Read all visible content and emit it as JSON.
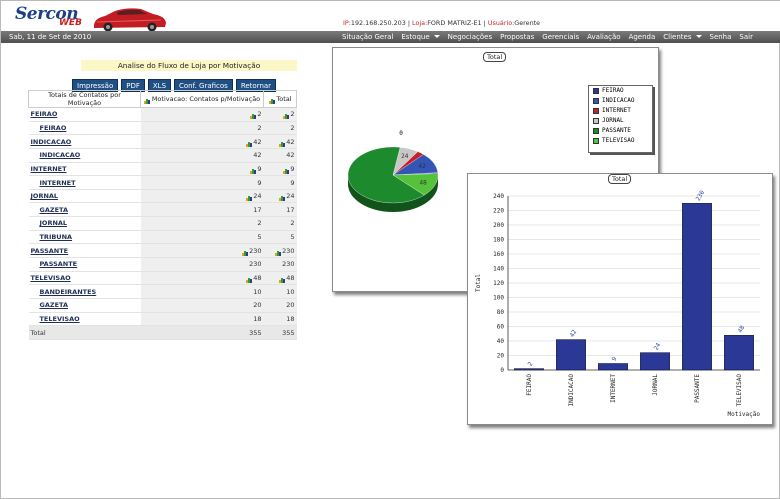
{
  "header": {
    "logo_main": "Sercon",
    "logo_sub": "WEB",
    "ip_label": "IP:",
    "ip_value": "192.168.250.203",
    "sep1": " | ",
    "loja_label": "Loja:",
    "loja_value": "FORD MATRIZ-E1",
    "sep2": " | ",
    "user_label": "Usuário:",
    "user_value": "Gerente"
  },
  "nav": {
    "date": "Sab, 11 de Set de 2010",
    "menu": [
      "Situação Geral",
      "Estoque",
      "Negociações",
      "Propostas",
      "Gerenciais",
      "Avaliação",
      "Agenda",
      "Clientes",
      "Senha",
      "Sair"
    ]
  },
  "report": {
    "title": "Analise do Fluxo de Loja por Motivação",
    "buttons": [
      "Impressão",
      "PDF",
      "XLS",
      "Conf. Graficos",
      "Retornar"
    ],
    "headers": [
      "Totais de Contatos por Motivação",
      "Motivacao: Contatos p/Motivação",
      "Total"
    ],
    "rows": [
      {
        "label": "FEIRAO",
        "v1": "2",
        "v2": "2",
        "type": "group"
      },
      {
        "label": "FEIRAO",
        "v1": "2",
        "v2": "2",
        "type": "sub"
      },
      {
        "label": "INDICACAO",
        "v1": "42",
        "v2": "42",
        "type": "group"
      },
      {
        "label": "INDICACAO",
        "v1": "42",
        "v2": "42",
        "type": "sub"
      },
      {
        "label": "INTERNET",
        "v1": "9",
        "v2": "9",
        "type": "group"
      },
      {
        "label": "INTERNET",
        "v1": "9",
        "v2": "9",
        "type": "sub"
      },
      {
        "label": "JORNAL",
        "v1": "24",
        "v2": "24",
        "type": "group"
      },
      {
        "label": "GAZETA",
        "v1": "17",
        "v2": "17",
        "type": "sub"
      },
      {
        "label": "JORNAL",
        "v1": "2",
        "v2": "2",
        "type": "sub"
      },
      {
        "label": "TRIBUNA",
        "v1": "5",
        "v2": "5",
        "type": "sub"
      },
      {
        "label": "PASSANTE",
        "v1": "230",
        "v2": "230",
        "type": "group"
      },
      {
        "label": "PASSANTE",
        "v1": "230",
        "v2": "230",
        "type": "sub"
      },
      {
        "label": "TELEVISAO",
        "v1": "48",
        "v2": "48",
        "type": "group"
      },
      {
        "label": "BANDEIRANTES",
        "v1": "10",
        "v2": "10",
        "type": "sub"
      },
      {
        "label": "GAZETA",
        "v1": "20",
        "v2": "20",
        "type": "sub"
      },
      {
        "label": "TELEVISAO",
        "v1": "18",
        "v2": "18",
        "type": "sub"
      },
      {
        "label": "Total",
        "v1": "355",
        "v2": "355",
        "type": "total"
      }
    ]
  },
  "chart_data": [
    {
      "type": "pie",
      "title": "Total",
      "top_label": "0",
      "categories": [
        "FEIRAO",
        "INDICACAO",
        "INTERNET",
        "JORNAL",
        "PASSANTE",
        "TELEVISAO"
      ],
      "values": [
        2,
        42,
        9,
        24,
        230,
        48
      ],
      "colors": [
        "#2b3896",
        "#3355b5",
        "#c8202a",
        "#c8c8c8",
        "#1e8a2e",
        "#55c23c"
      ],
      "slice_labels": [
        "",
        "42",
        "",
        "24",
        "",
        "48"
      ],
      "legend_position": "top-right"
    },
    {
      "type": "bar",
      "title": "Total",
      "xlabel": "Motivação",
      "ylabel": "Total",
      "categories": [
        "FEIRAO",
        "INDICACAO",
        "INTERNET",
        "JORNAL",
        "PASSANTE",
        "TELEVISAO"
      ],
      "values": [
        2,
        42,
        9,
        24,
        230,
        48
      ],
      "ylim": [
        0,
        240
      ],
      "yticks": [
        0,
        20,
        40,
        60,
        80,
        100,
        120,
        140,
        160,
        180,
        200,
        220,
        240
      ],
      "bar_color": "#2b3896",
      "grid": true
    }
  ]
}
